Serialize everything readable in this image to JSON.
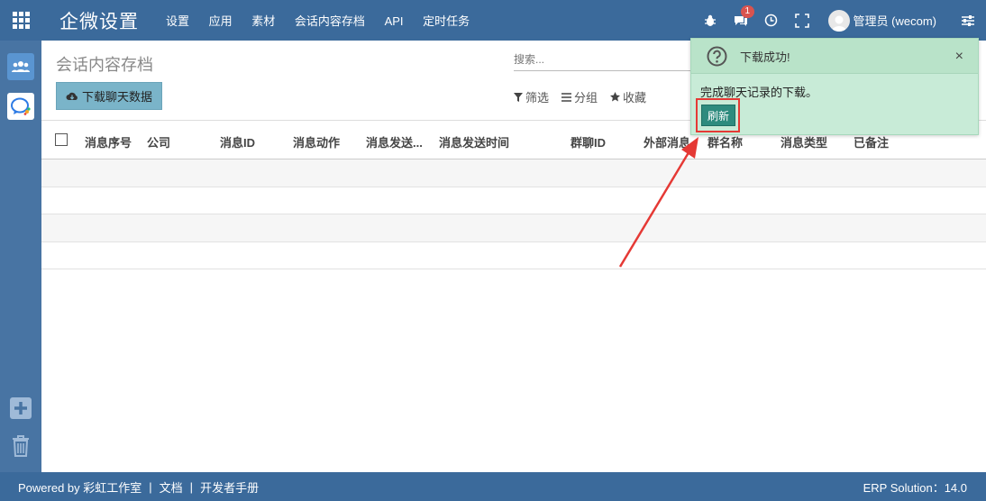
{
  "topbar": {
    "brand": "企微设置",
    "menu": [
      "设置",
      "应用",
      "素材",
      "会话内容存档",
      "API",
      "定时任务"
    ],
    "message_count": "1",
    "user_name": "管理员 (wecom)"
  },
  "sidebar": {
    "items": [
      {
        "name": "users-icon",
        "active": true
      },
      {
        "name": "wecom-icon",
        "active": false
      }
    ],
    "bottom": [
      "plus-icon",
      "trash-icon"
    ]
  },
  "control_panel": {
    "breadcrumb": "会话内容存档",
    "search_placeholder": "搜索...",
    "download_button": "下载聊天数据",
    "filter_label": "筛选",
    "group_label": "分组",
    "favorite_label": "收藏"
  },
  "table": {
    "columns": [
      "消息序号",
      "公司",
      "消息ID",
      "消息动作",
      "消息发送...",
      "消息发送时间",
      "群聊ID",
      "外部消息",
      "群名称",
      "消息类型",
      "已备注"
    ],
    "row_count": 4
  },
  "notification": {
    "title": "下载成功!",
    "message": "完成聊天记录的下载。",
    "button": "刷新",
    "close": "×"
  },
  "footer": {
    "powered_by": "Powered by 彩虹工作室",
    "sep": "|",
    "docs": "文档",
    "dev_manual": "开发者手册",
    "version": "ERP Solution：14.0"
  },
  "colors": {
    "navbar": "#3b6a9b",
    "sidebar": "#4874a3",
    "notification": "#c8ebd7",
    "refresh_button": "#2e8b7e",
    "highlight": "#e53935"
  }
}
